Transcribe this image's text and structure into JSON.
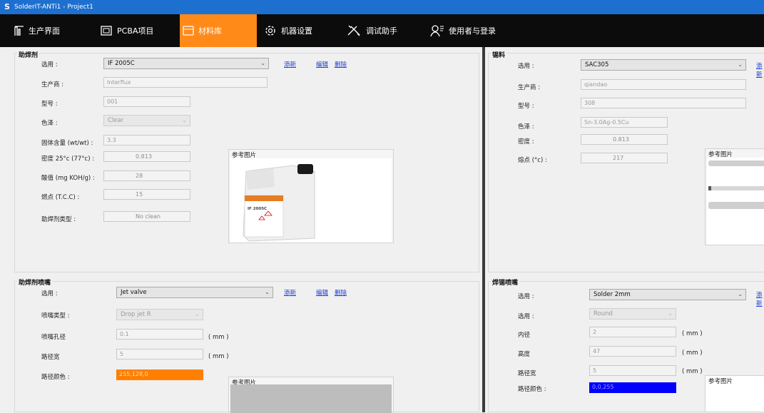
{
  "window": {
    "title": "SolderIT-ANTi1 - Project1"
  },
  "nav": {
    "items": [
      {
        "label": "生产界面"
      },
      {
        "label": "PCBA项目"
      },
      {
        "label": "材料库"
      },
      {
        "label": "机器设置"
      },
      {
        "label": "调试助手"
      },
      {
        "label": "使用者与登录"
      }
    ]
  },
  "flux": {
    "title": "助焊剂",
    "select_label": "选用 :",
    "select_value": "IF 2005C",
    "new_link": "添新",
    "edit_link": "编辑",
    "delete_link": "删除",
    "manufacturer_label": "生产商 :",
    "manufacturer": "Interflux",
    "model_label": "型号 :",
    "model": "001",
    "color_label": "色泽 :",
    "color": "Clear",
    "solid_label": "固体含量 (wt/wt) :",
    "solid": "3.3",
    "density_label": "密度 25°c (77°c) :",
    "density": "0.813",
    "acid_label": "酸值 (mg KOH/g) :",
    "acid": "28",
    "flash_label": "燃点 (T.C.C) :",
    "flash": "15",
    "type_label": "助焊剂类型 :",
    "type": "No clean",
    "ref_image_label": "参考图片",
    "product_text": "IF 2005C"
  },
  "flux_nozzle": {
    "title": "助焊剂喷嘴",
    "select_label": "选用 :",
    "select_value": "Jet valve",
    "new_link": "添新",
    "edit_link": "编辑",
    "delete_link": "删除",
    "nozzle_type_label": "喷嘴类型 :",
    "nozzle_type": "Drop jet R",
    "hole_label": "喷嘴孔径",
    "hole": "0.1",
    "hole_unit": "( mm )",
    "path_width_label": "路径宽",
    "path_width": "5",
    "path_width_unit": "( mm )",
    "path_color_label": "路径颜色 :",
    "path_color": "255,128,0",
    "path_color_hex": "#ff8000",
    "ref_image_label": "参考图片"
  },
  "solder": {
    "title": "锡料",
    "select_label": "选用 :",
    "select_value": "SAC305",
    "new_link": "添新",
    "manufacturer_label": "生产商 :",
    "manufacturer": "qiandao",
    "model_label": "型号 :",
    "model": "308",
    "color_label": "色泽 :",
    "color": "Sn-3.0Ag-0.5Cu",
    "density_label": "密度 :",
    "density": "0.813",
    "melting_label": "熔点 (°c) :",
    "melting": "217",
    "ref_image_label": "参考图片"
  },
  "solder_nozzle": {
    "title": "焊锡喷嘴",
    "select_label": "选用 :",
    "select_value": "Solder 2mm",
    "new_link": "添新",
    "shape_label": "选用 :",
    "shape": "Round",
    "inner_label": "内径",
    "inner": "2",
    "inner_unit": "( mm )",
    "height_label": "高度",
    "height": "47",
    "height_unit": "( mm )",
    "path_width_label": "路径宽",
    "path_width": "5",
    "path_width_unit": "( mm )",
    "path_color_label": "路径颜色 :",
    "path_color": "0,0,255",
    "path_color_hex": "#0000ff",
    "ref_image_label": "参考图片"
  },
  "colors": {
    "accent": "#ff8a18",
    "titlebar": "#1d6fd0",
    "navbar": "#0c0c0c"
  }
}
